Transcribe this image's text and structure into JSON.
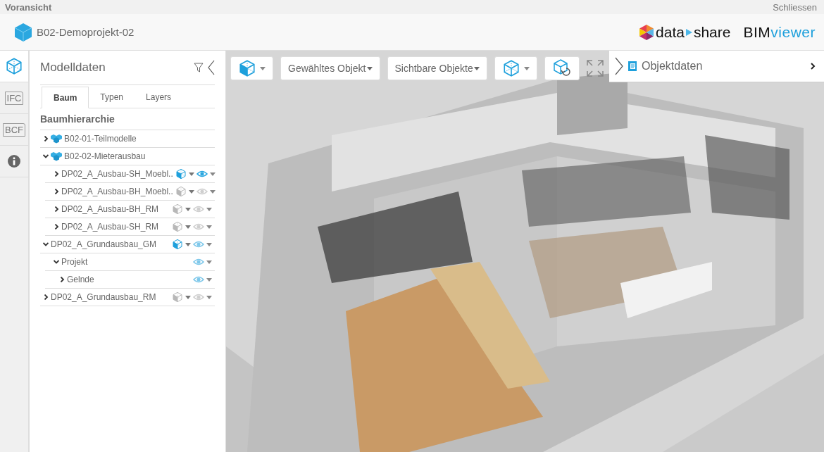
{
  "title_bar": {
    "title": "Voransicht",
    "close": "Schliessen"
  },
  "header": {
    "project": "B02-Demoprojekt-02",
    "brand": {
      "part_1": "data",
      "part_2": "share",
      "product_1": "BIM",
      "product_2": "viewer"
    }
  },
  "rail": [
    {
      "kind": "cube",
      "selected": true
    },
    {
      "kind": "tag",
      "label": "IFC",
      "selected": false
    },
    {
      "kind": "tag",
      "label": "BCF",
      "selected": false
    },
    {
      "kind": "info",
      "selected": false
    }
  ],
  "panel": {
    "title": "Modelldaten",
    "tabs": [
      {
        "label": "Baum",
        "selected": true
      },
      {
        "label": "Typen",
        "selected": false
      },
      {
        "label": "Layers",
        "selected": false
      }
    ],
    "heading": "Baumhierarchie",
    "tree": [
      {
        "kind": "folder",
        "label": "B02-01-Teilmodelle",
        "expanded": false
      },
      {
        "kind": "folder",
        "label": "B02-02-Mieterausbau",
        "expanded": true,
        "children": [
          {
            "kind": "model",
            "label": "DP02_A_Ausbau-SH_Moebl..",
            "expanded": false,
            "active": true,
            "visible": true
          },
          {
            "kind": "model",
            "label": "DP02_A_Ausbau-BH_Moebl..",
            "expanded": false,
            "active": false,
            "visible": false
          },
          {
            "kind": "model",
            "label": "DP02_A_Ausbau-BH_RM",
            "expanded": false,
            "active": false,
            "visible": false
          },
          {
            "kind": "model",
            "label": "DP02_A_Ausbau-SH_RM",
            "expanded": false,
            "active": false,
            "visible": false
          }
        ]
      },
      {
        "kind": "model",
        "label": "DP02_A_Grundausbau_GM",
        "expanded": true,
        "active": true,
        "visible": true,
        "children": [
          {
            "kind": "node",
            "label": "Projekt",
            "expanded": true,
            "visible": true,
            "children": [
              {
                "kind": "node",
                "label": "Gelnde",
                "expanded": false,
                "visible": true
              }
            ]
          }
        ]
      },
      {
        "kind": "model",
        "label": "DP02_A_Grundausbau_RM",
        "expanded": false,
        "active": false,
        "visible": false
      }
    ]
  },
  "viewer": {
    "toolbar": [
      {
        "kind": "mode"
      },
      {
        "kind": "menu",
        "label": "Gewähltes Objekt"
      },
      {
        "kind": "menu",
        "label": "Sichtbare Objekte"
      },
      {
        "kind": "cube"
      },
      {
        "kind": "reset"
      },
      {
        "kind": "fullscreen"
      }
    ]
  },
  "object_panel": {
    "title": "Objektdaten"
  }
}
